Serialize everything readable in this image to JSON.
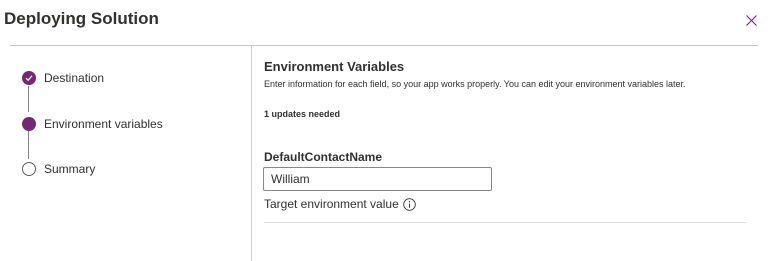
{
  "dialog": {
    "title": "Deploying Solution"
  },
  "steps": [
    {
      "label": "Destination",
      "state": "completed"
    },
    {
      "label": "Environment variables",
      "state": "current"
    },
    {
      "label": "Summary",
      "state": "pending"
    }
  ],
  "content": {
    "section_title": "Environment Variables",
    "description": "Enter information for each field, so your app works properly. You can edit your environment variables later.",
    "updates_needed": "1 updates needed",
    "field": {
      "label": "DefaultContactName",
      "value": "William",
      "hint": "Target environment value"
    }
  },
  "colors": {
    "accent": "#742774",
    "text": "#323130",
    "divider": "#c8c6c4"
  },
  "icons": {
    "close": "close-icon",
    "check": "checkmark-icon",
    "info": "info-icon"
  }
}
